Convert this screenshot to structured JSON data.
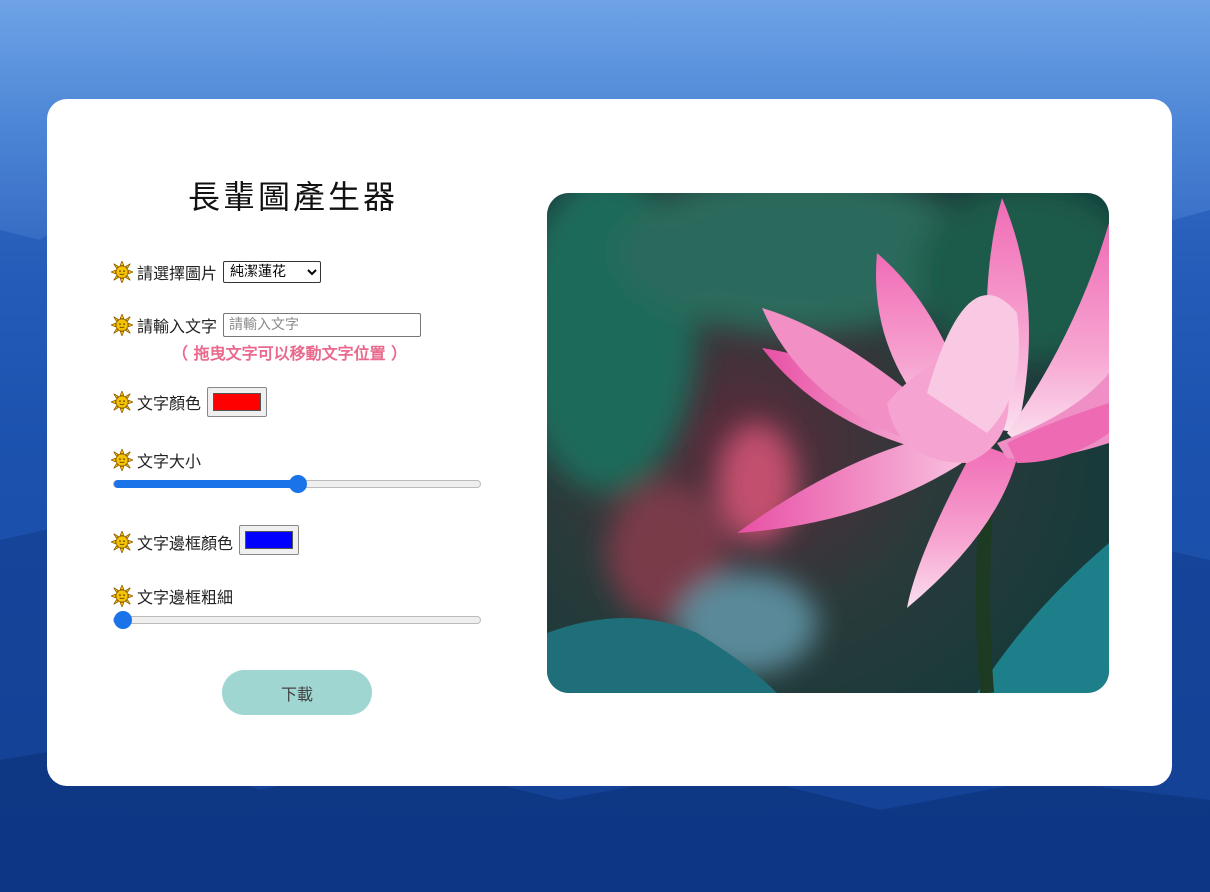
{
  "app": {
    "title": "長輩圖產生器"
  },
  "controls": {
    "image_select": {
      "label": "請選擇圖片",
      "selected": "純潔蓮花"
    },
    "text_input": {
      "label": "請輸入文字",
      "placeholder": "請輸入文字",
      "value": ""
    },
    "drag_hint": "（ 拖曳文字可以移動文字位置 ）",
    "text_color": {
      "label": "文字顏色",
      "value": "#ff0000"
    },
    "text_size": {
      "label": "文字大小",
      "level": 0.5
    },
    "stroke_color": {
      "label": "文字邊框顏色",
      "value": "#0000ff"
    },
    "stroke_width": {
      "label": "文字邊框粗細",
      "level": 0.0
    },
    "download_label": "下載"
  },
  "preview": {
    "image": "lotus-flower",
    "icon_name": "sun-face-icon"
  },
  "colors": {
    "accent": "#1a73e8",
    "button": "#9fd6d1",
    "hint": "#e96a8d"
  }
}
